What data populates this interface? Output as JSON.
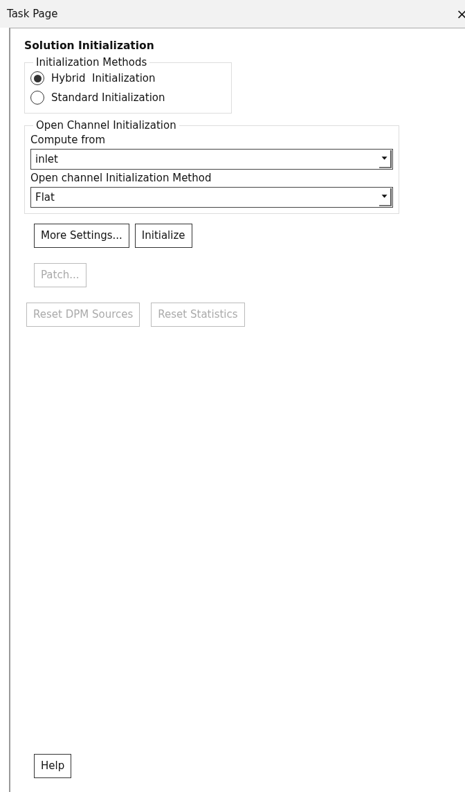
{
  "window": {
    "title": "Task Page",
    "close": "×"
  },
  "heading": "Solution Initialization",
  "methods": {
    "legend": "Initialization Methods",
    "options": [
      {
        "label": "Hybrid  Initialization",
        "selected": true
      },
      {
        "label": "Standard Initialization",
        "selected": false
      }
    ]
  },
  "open_channel": {
    "legend": "Open Channel Initialization",
    "fields": [
      {
        "label": "Compute from",
        "value": "inlet"
      },
      {
        "label": "Open channel Initialization Method",
        "value": "Flat"
      }
    ]
  },
  "button_rows": [
    [
      {
        "label": "More Settings...",
        "disabled": false
      },
      {
        "label": "Initialize",
        "disabled": false
      }
    ],
    [
      {
        "label": "Patch...",
        "disabled": true
      }
    ],
    [
      {
        "label": "Reset DPM Sources",
        "disabled": true
      },
      {
        "label": "Reset Statistics",
        "disabled": true
      }
    ]
  ],
  "help_button": {
    "label": "Help",
    "disabled": false
  }
}
